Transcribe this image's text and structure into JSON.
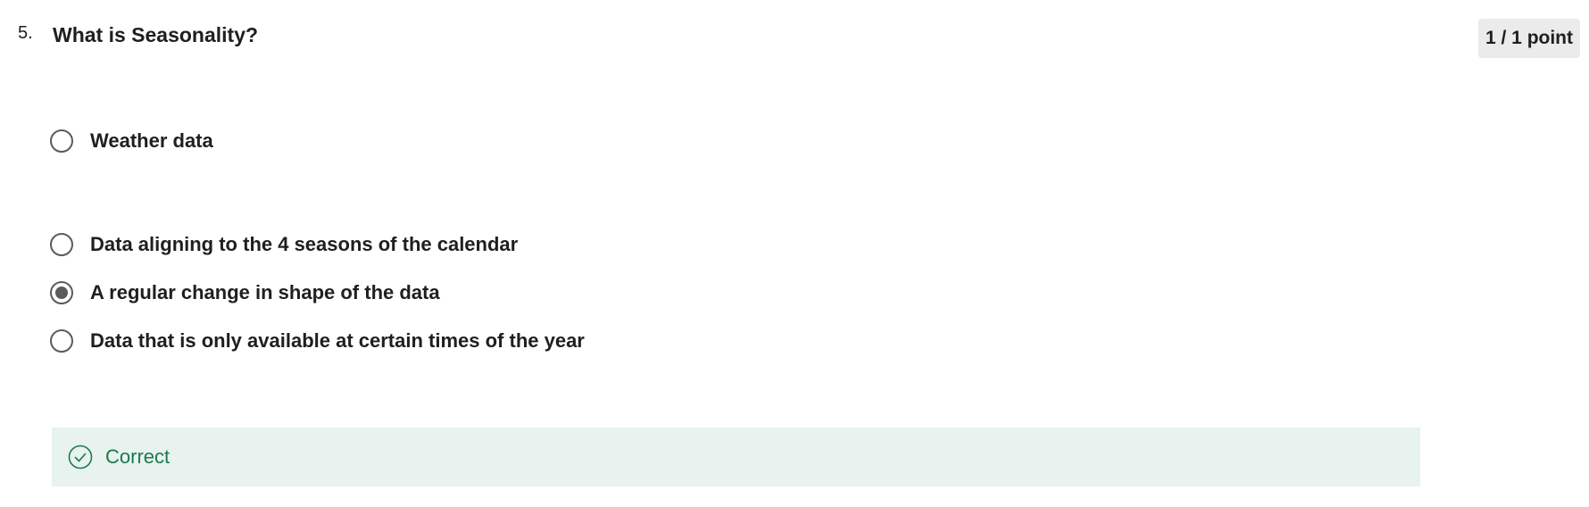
{
  "question": {
    "number": "5.",
    "title": "What is Seasonality?",
    "points": "1 / 1 point"
  },
  "options": [
    {
      "label": "Weather data",
      "selected": false
    },
    {
      "label": "Data aligning to the 4 seasons of the calendar",
      "selected": false
    },
    {
      "label": "A regular change in shape of the data",
      "selected": true
    },
    {
      "label": "Data that is only available at certain times of the year",
      "selected": false
    }
  ],
  "feedback": {
    "status": "Correct",
    "icon": "check-circle-icon",
    "text_color": "#1a7a4c",
    "background_color": "#e8f2ee"
  },
  "colors": {
    "radio_border": "#5b5b5b",
    "badge_background": "#ebebeb"
  }
}
